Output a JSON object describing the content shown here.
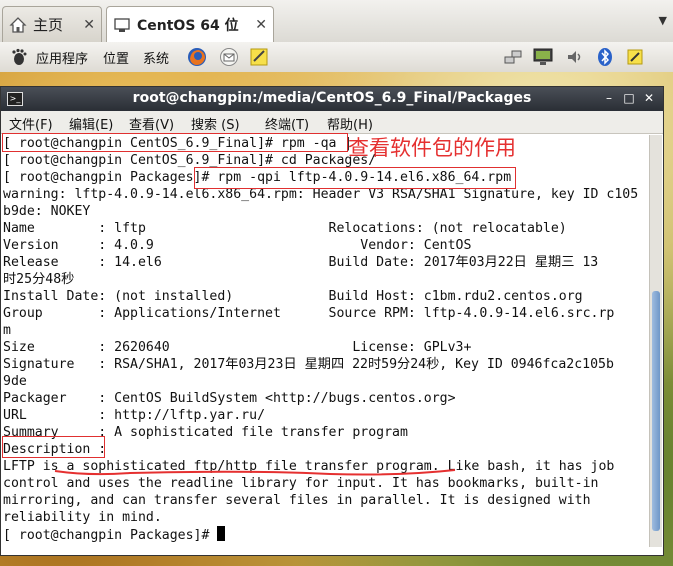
{
  "host_tabs": [
    {
      "label": "主页",
      "icon": "home-icon"
    },
    {
      "label": "CentOS 64 位",
      "icon": "vm-icon"
    }
  ],
  "panel": {
    "menus": [
      "应用程序",
      "位置",
      "系统"
    ]
  },
  "window": {
    "title": "root@changpin:/media/CentOS_6.9_Final/Packages",
    "menu": [
      "文件(F)",
      "编辑(E)",
      "查看(V)",
      "搜索 (S)",
      "终端(T)",
      "帮助(H)"
    ]
  },
  "terminal": {
    "lines": [
      "[ root@changpin CentOS_6.9_Final]# rpm -qa |",
      "[ root@changpin CentOS_6.9_Final]# cd Packages/",
      "[ root@changpin Packages]# rpm -qpi lftp-4.0.9-14.el6.x86_64.rpm",
      "warning: lftp-4.0.9-14.el6.x86_64.rpm: Header V3 RSA/SHA1 Signature, key ID c105",
      "b9de: NOKEY",
      "Name        : lftp                       Relocations: (not relocatable)",
      "Version     : 4.0.9                          Vendor: CentOS",
      "Release     : 14.el6                     Build Date: 2017年03月22日 星期三 13",
      "时25分48秒",
      "Install Date: (not installed)            Build Host: c1bm.rdu2.centos.org",
      "Group       : Applications/Internet      Source RPM: lftp-4.0.9-14.el6.src.rp",
      "m",
      "Size        : 2620640                       License: GPLv3+",
      "Signature   : RSA/SHA1, 2017年03月23日 星期四 22时59分24秒, Key ID 0946fca2c105b",
      "9de",
      "Packager    : CentOS BuildSystem <http://bugs.centos.org>",
      "URL         : http://lftp.yar.ru/",
      "Summary     : A sophisticated file transfer program",
      "Description :",
      "LFTP is a sophisticated ftp/http file transfer program. Like bash, it has job",
      "control and uses the readline library for input. It has bookmarks, built-in",
      "mirroring, and can transfer several files in parallel. It is designed with",
      "reliability in mind."
    ],
    "prompt": "[ root@changpin Packages]# "
  },
  "annotation": "查看软件包的作用",
  "colors": {
    "annotation": "#e53030",
    "titlebar": "#2f333a",
    "scroll_thumb": "#7aa0cf"
  }
}
